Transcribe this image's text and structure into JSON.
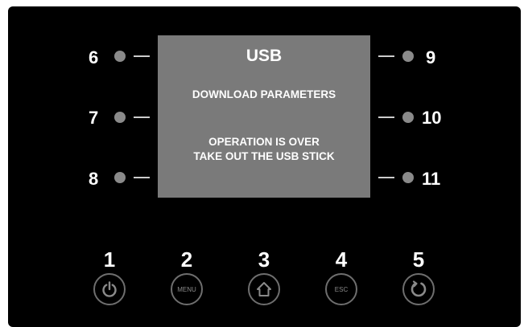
{
  "screen": {
    "title": "USB",
    "message_1": "DOWNLOAD PARAMETERS",
    "message_2_line_1": "OPERATION IS OVER",
    "message_2_line_2": "TAKE OUT THE USB STICK"
  },
  "side_keys": {
    "left": [
      "6",
      "7",
      "8"
    ],
    "right": [
      "9",
      "10",
      "11"
    ]
  },
  "bottom_buttons": [
    {
      "number": "1",
      "icon": "power-icon",
      "label": ""
    },
    {
      "number": "2",
      "icon": "",
      "label": "MENU"
    },
    {
      "number": "3",
      "icon": "home-icon",
      "label": ""
    },
    {
      "number": "4",
      "icon": "",
      "label": "ESC"
    },
    {
      "number": "5",
      "icon": "refresh-icon",
      "label": ""
    }
  ],
  "colors": {
    "panel": "#000000",
    "screen": "#7a7a7a",
    "text": "#ffffff",
    "key_dot": "#8a8a8a",
    "button_ring": "#6e6e6e"
  }
}
